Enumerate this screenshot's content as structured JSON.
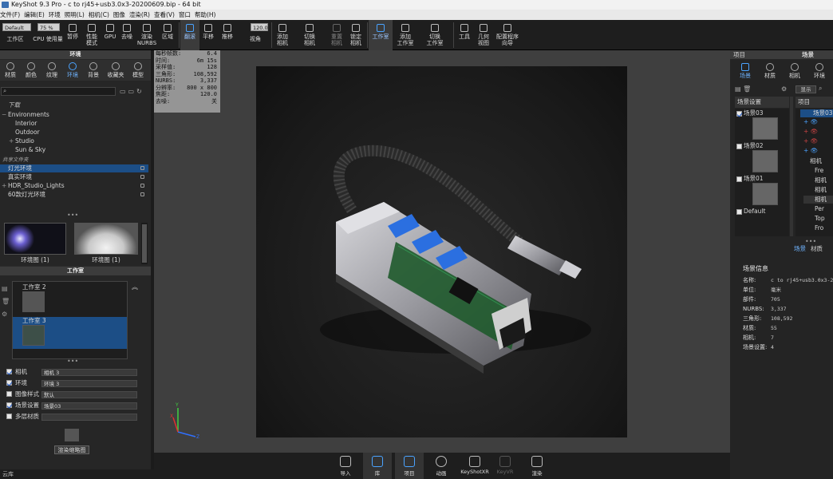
{
  "window": {
    "title": "KeyShot 9.3 Pro  - c to rj45+usb3.0x3-20200609.bip  - 64 bit"
  },
  "menu": [
    "文件(F)",
    "编辑(E)",
    "环境",
    "照明(L)",
    "相机(C)",
    "图像",
    "渲染(R)",
    "查看(V)",
    "窗口",
    "帮助(H)"
  ],
  "toolbar": {
    "workspace_select": "Default",
    "cpu_value": "75 %",
    "fov_value": "120.0",
    "buttons": [
      {
        "label": "工作区"
      },
      {
        "label": "CPU 使用量"
      },
      {
        "label": "暂停"
      },
      {
        "label": "性能\n模式"
      },
      {
        "label": "GPU"
      },
      {
        "label": "去噪"
      },
      {
        "label": "渲染\nNURBS"
      },
      {
        "label": "区域"
      },
      {
        "label": "翻滚"
      },
      {
        "label": "平移"
      },
      {
        "label": "推移"
      },
      {
        "label": "视角"
      },
      {
        "label": "添加\n相机"
      },
      {
        "label": "切换\n相机"
      },
      {
        "label": "重置\n相机"
      },
      {
        "label": "锁定\n相机"
      },
      {
        "label": "工作室"
      },
      {
        "label": "添加\n工作室"
      },
      {
        "label": "切换\n工作室"
      },
      {
        "label": "工具"
      },
      {
        "label": "几何\n视图"
      },
      {
        "label": "配置程序\n向导"
      }
    ]
  },
  "library": {
    "title": "环境",
    "tabs": [
      "材质",
      "颜色",
      "纹理",
      "环境",
      "背景",
      "收藏夹",
      "模型"
    ],
    "tree_header": "下载",
    "tree": [
      {
        "label": "Environments",
        "indent": 0,
        "selected": false
      },
      {
        "label": "Interior",
        "indent": 1,
        "selected": false
      },
      {
        "label": "Outdoor",
        "indent": 1,
        "selected": false
      },
      {
        "label": "Studio",
        "indent": 1,
        "selected": false
      },
      {
        "label": "Sun & Sky",
        "indent": 1,
        "selected": false
      }
    ],
    "shared_header": "共享文件夹",
    "shared": [
      {
        "label": "灯光环境",
        "selected": true
      },
      {
        "label": "真实环境",
        "selected": false
      },
      {
        "label": "HDR_Studio_Lights",
        "selected": false
      },
      {
        "label": "60款灯光环境",
        "selected": false
      }
    ],
    "thumbs": [
      {
        "label": "环境图 (1)"
      },
      {
        "label": "环境图 (1)"
      }
    ]
  },
  "studio": {
    "title": "工作室",
    "items": [
      {
        "label": "工作室 2",
        "selected": false
      },
      {
        "label": "工作室 3",
        "selected": true
      }
    ],
    "settings": [
      {
        "label": "相机",
        "checked": true,
        "value": "相机 3"
      },
      {
        "label": "环境",
        "checked": true,
        "value": "环境 3"
      },
      {
        "label": "图像样式",
        "checked": false,
        "value": "默认"
      },
      {
        "label": "场景设置",
        "checked": true,
        "value": "场景03"
      },
      {
        "label": "多层材质",
        "checked": false,
        "value": ""
      }
    ],
    "render_thumb_button": "渲染缩略图"
  },
  "stats": [
    {
      "k": "每秒帧数:",
      "v": "6.4"
    },
    {
      "k": "时间:",
      "v": "6m 15s"
    },
    {
      "k": "采样值:",
      "v": "128"
    },
    {
      "k": "三角形:",
      "v": "108,592"
    },
    {
      "k": "NURBS:",
      "v": "3,337"
    },
    {
      "k": "分辨率:",
      "v": "800 x 800"
    },
    {
      "k": "焦距:",
      "v": "120.0"
    },
    {
      "k": "去噪:",
      "v": "关"
    }
  ],
  "axis": {
    "x": "X",
    "y": "Y",
    "z": "Z"
  },
  "bottombar": [
    {
      "label": "导入"
    },
    {
      "label": "库"
    },
    {
      "label": "项目"
    },
    {
      "label": "动画"
    },
    {
      "label": "KeyShotXR"
    },
    {
      "label": "KeyVR"
    },
    {
      "label": "渲染"
    }
  ],
  "statusbar": {
    "text": "云库"
  },
  "project": {
    "title": "项目",
    "scene_title": "场景",
    "tabs": [
      "场景",
      "材质",
      "相机",
      "环境"
    ],
    "scene_settings_header": "场景设置",
    "scene_sets": [
      {
        "label": "场景03",
        "checked": true
      },
      {
        "label": "场景02",
        "checked": false
      },
      {
        "label": "场景01",
        "checked": false
      },
      {
        "label": "Default",
        "checked": false
      }
    ],
    "display_button": "显示",
    "tree_header": "项目",
    "tree": [
      {
        "label": "场景03"
      },
      {
        "label": ""
      },
      {
        "label": ""
      },
      {
        "label": ""
      },
      {
        "label": ""
      },
      {
        "label": "相机"
      },
      {
        "label": "Fre"
      },
      {
        "label": "相机"
      },
      {
        "label": "相机"
      },
      {
        "label": "相机"
      },
      {
        "label": "Per"
      },
      {
        "label": "Top"
      },
      {
        "label": "Fro"
      }
    ],
    "subtabs": [
      "场景",
      "材质"
    ],
    "info_title": "场景信息",
    "info": [
      {
        "k": "名称:",
        "v": "c to rj45+usb3.0x3-202"
      },
      {
        "k": "单位:",
        "v": "毫米"
      },
      {
        "k": "部件:",
        "v": "705"
      },
      {
        "k": "NURBS:",
        "v": "3,337"
      },
      {
        "k": "三角形:",
        "v": "108,592"
      },
      {
        "k": "材质:",
        "v": "55"
      },
      {
        "k": "相机:",
        "v": "7"
      },
      {
        "k": "场景设置:",
        "v": "4"
      }
    ]
  },
  "colors": {
    "accent": "#4aa3ff",
    "selection": "#1c4e86"
  }
}
